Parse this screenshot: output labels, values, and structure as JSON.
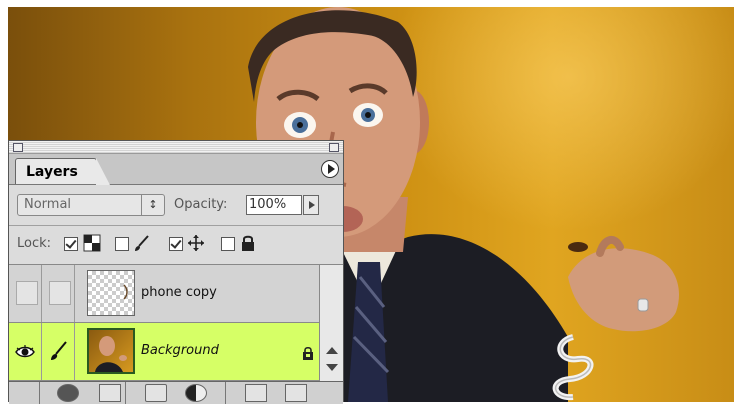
{
  "palette": {
    "tab_label": "Layers",
    "blend_mode": "Normal",
    "opacity_label": "Opacity:",
    "opacity_value": "100%",
    "lock_label": "Lock:",
    "lock_options": [
      {
        "name": "transparent-pixels",
        "checked": true
      },
      {
        "name": "image-pixels",
        "checked": false
      },
      {
        "name": "position",
        "checked": true
      },
      {
        "name": "all",
        "checked": false
      }
    ],
    "layers": [
      {
        "name": "phone copy",
        "visible": false,
        "selected": false,
        "locked": false
      },
      {
        "name": "Background",
        "visible": true,
        "selected": true,
        "locked": true
      }
    ],
    "colors": {
      "selected_row": "#d6ff66",
      "panel_bg": "#dcdcdc"
    },
    "bottom_icons": [
      "layer-style-icon",
      "layer-mask-icon",
      "new-layer-set-icon",
      "adjustment-layer-icon",
      "new-layer-icon",
      "trash-icon"
    ]
  }
}
